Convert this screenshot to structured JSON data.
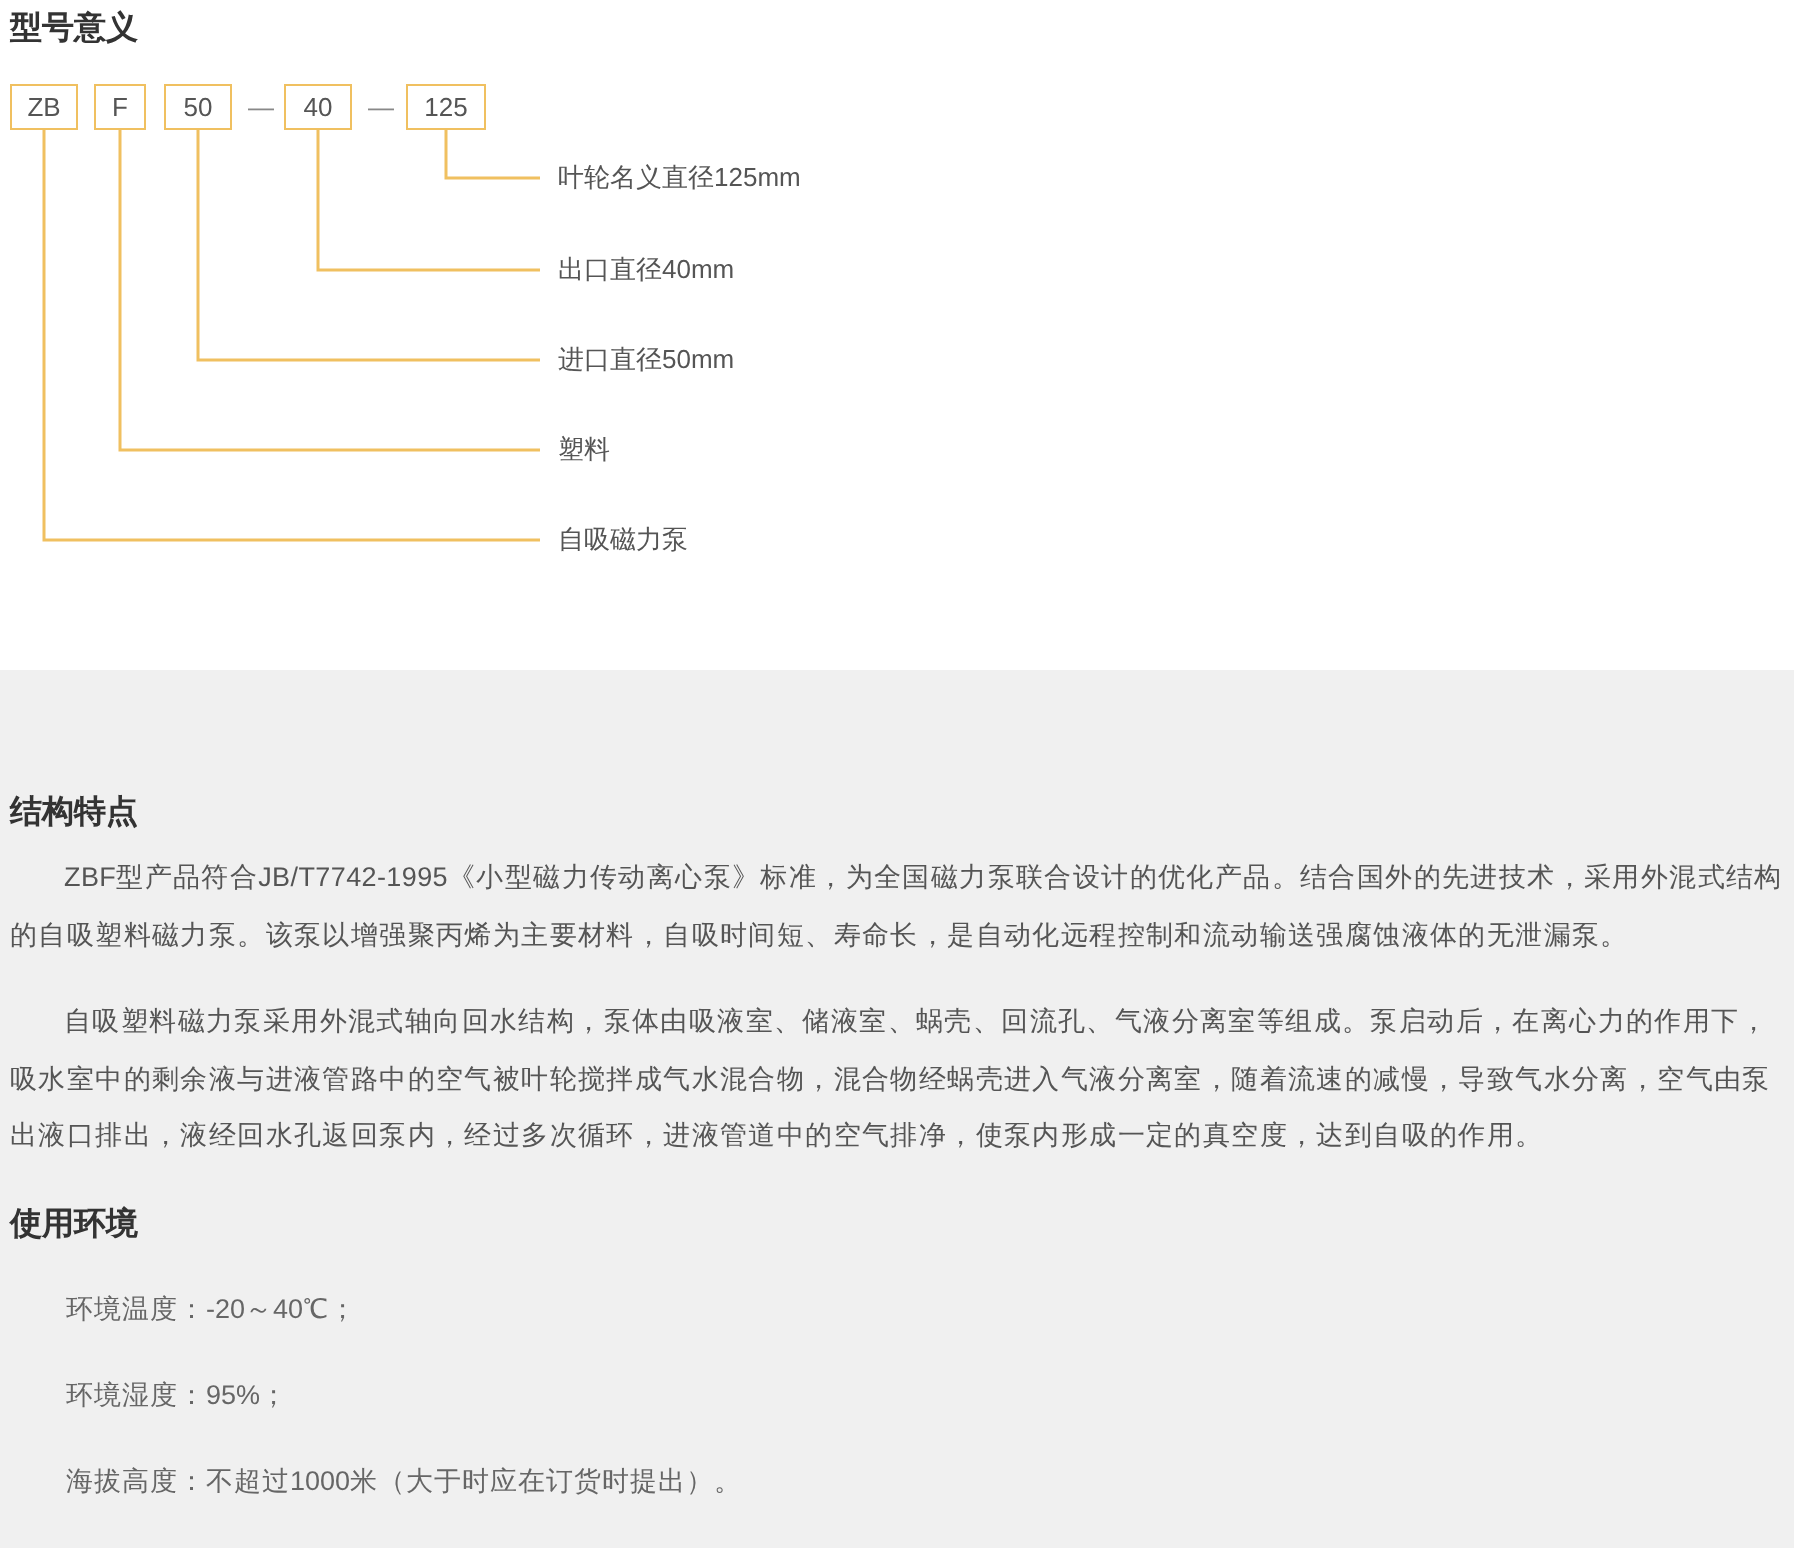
{
  "model_meaning": {
    "heading": "型号意义",
    "codes": [
      "ZB",
      "F",
      "50",
      "40",
      "125"
    ],
    "labels": [
      "叶轮名义直径125mm",
      "出口直径40mm",
      "进口直径50mm",
      "塑料",
      "自吸磁力泵"
    ],
    "separators": [
      "—",
      "—"
    ]
  },
  "structure": {
    "heading": "结构特点",
    "paragraphs": [
      "ZBF型产品符合JB/T7742-1995《小型磁力传动离心泵》标准，为全国磁力泵联合设计的优化产品。结合国外的先进技术，采用外混式结构的自吸塑料磁力泵。该泵以增强聚丙烯为主要材料，自吸时间短、寿命长，是自动化远程控制和流动输送强腐蚀液体的无泄漏泵。",
      "自吸塑料磁力泵采用外混式轴向回水结构，泵体由吸液室、储液室、蜗壳、回流孔、气液分离室等组成。泵启动后，在离心力的作用下，吸水室中的剩余液与进液管路中的空气被叶轮搅拌成气水混合物，混合物经蜗壳进入气液分离室，随着流速的减慢，导致气水分离，空气由泵出液口排出，液经回水孔返回泵内，经过多次循环，进液管道中的空气排净，使泵内形成一定的真空度，达到自吸的作用。"
    ]
  },
  "environment": {
    "heading": "使用环境",
    "items": [
      "环境温度：-20～40℃；",
      "环境湿度：95%；",
      "海拔高度：不超过1000米（大于时应在订货时提出）。"
    ]
  }
}
